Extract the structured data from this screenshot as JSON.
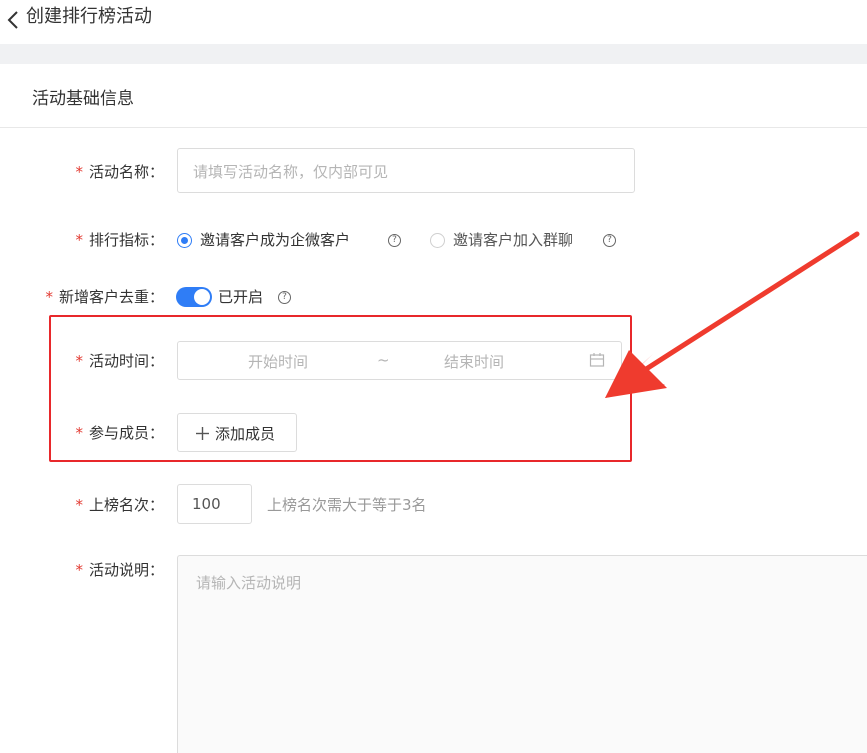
{
  "header": {
    "title": "创建排行榜活动"
  },
  "section": {
    "title": "活动基础信息"
  },
  "form": {
    "name": {
      "label": "活动名称：",
      "placeholder": "请填写活动名称，仅内部可见"
    },
    "metric": {
      "label": "排行指标：",
      "options": [
        {
          "label": "邀请客户成为企微客户",
          "selected": true
        },
        {
          "label": "邀请客户加入群聊",
          "selected": false
        }
      ]
    },
    "dedupe": {
      "label": "新增客户去重：",
      "status": "已开启"
    },
    "time": {
      "label": "活动时间：",
      "start_placeholder": "开始时间",
      "separator": "~",
      "end_placeholder": "结束时间"
    },
    "members": {
      "label": "参与成员：",
      "button": "添加成员"
    },
    "rank": {
      "label": "上榜名次：",
      "value": "100",
      "hint": "上榜名次需大于等于3名"
    },
    "description": {
      "label": "活动说明：",
      "placeholder": "请输入活动说明"
    }
  },
  "required_mark": "*",
  "colors": {
    "accent": "#2f7df6",
    "required": "#e23b33",
    "highlight": "#e8282b"
  }
}
